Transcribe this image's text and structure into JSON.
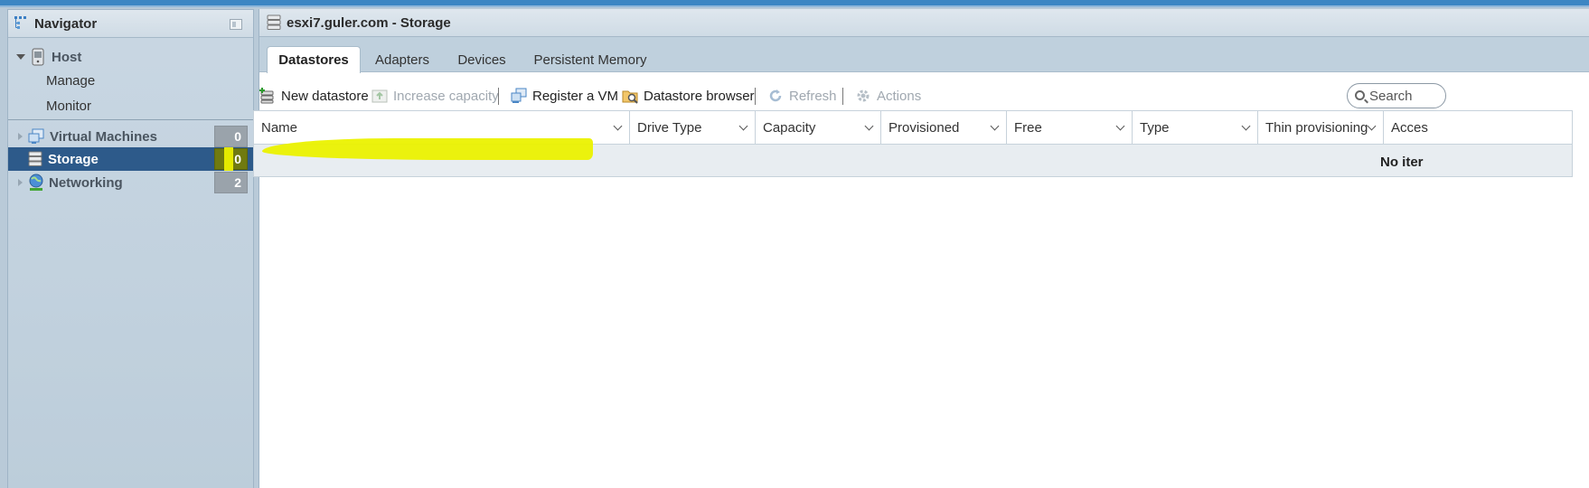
{
  "navigator": {
    "title": "Navigator",
    "items": [
      {
        "label": "Host",
        "icon": "server-icon",
        "expanded": true
      },
      {
        "label": "Manage"
      },
      {
        "label": "Monitor"
      },
      {
        "label": "Virtual Machines",
        "icon": "vm-icon",
        "count": "0"
      },
      {
        "label": "Storage",
        "icon": "storage-icon",
        "count": "0",
        "selected": true
      },
      {
        "label": "Networking",
        "icon": "network-icon",
        "count": "2"
      }
    ]
  },
  "main": {
    "title": "esxi7.guler.com - Storage",
    "tabs": [
      {
        "label": "Datastores",
        "active": true
      },
      {
        "label": "Adapters"
      },
      {
        "label": "Devices"
      },
      {
        "label": "Persistent Memory"
      }
    ],
    "toolbar": {
      "new_datastore": "New datastore",
      "increase_capacity": "Increase capacity",
      "register_vm": "Register a VM",
      "datastore_browser": "Datastore browser",
      "refresh": "Refresh",
      "actions": "Actions"
    },
    "search": {
      "placeholder": "Search"
    },
    "table": {
      "columns": [
        "Name",
        "Drive Type",
        "Capacity",
        "Provisioned",
        "Free",
        "Type",
        "Thin provisioning",
        "Acces"
      ],
      "empty_text": "No iter"
    }
  },
  "colors": {
    "selected_nav": "#2d5a8a",
    "highlight": "#ebf200",
    "accent": "#3c86c3"
  }
}
